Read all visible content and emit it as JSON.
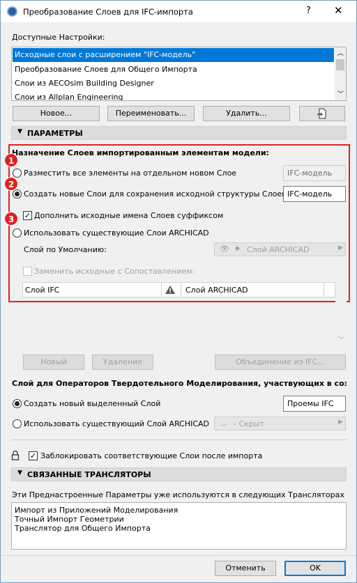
{
  "window": {
    "title": "Преобразование Слоев для IFC-импорта",
    "help": "?",
    "close": "✕"
  },
  "settings": {
    "label": "Доступные Настройки:",
    "items": [
      "Исходные слои с расширением \"IFC-модель\"",
      "Преобразование Слоев для Общего Импорта",
      "Слои из AECOsim Building Designer",
      "Слои из Allplan Engineering"
    ],
    "new_btn": "Новое...",
    "rename_btn": "Переименовать...",
    "delete_btn": "Удалить..."
  },
  "params": {
    "header": "ПАРАМЕТРЫ",
    "assign_label": "Назначение Слоев импортированным элементам модели:",
    "opt1": "Разместить все элементы на отдельном новом Слое",
    "opt1_value": "IFC-модель",
    "opt2": "Создать новые Слои для сохранения исходной структуры Слоев",
    "opt2_value": "IFC-модель",
    "suffix_check": "Дополнить исходные имена Слоев суффиксом",
    "suffix_mark": "✓",
    "opt3": "Использовать существующие Слои ARCHICAD",
    "default_layer_label": "Слой по Умолчанию:",
    "default_layer_value": "Слой ARCHICAD",
    "replace_check": "Заменить исходные с Сопоставлением:",
    "map_col1": "Слой IFC",
    "map_col2": "Слой ARCHICAD",
    "new_btn": "Новый",
    "delete_btn": "Удаление",
    "merge_btn": "Объединение из IFC...",
    "badges": [
      "1",
      "2",
      "3"
    ]
  },
  "solid_ops": {
    "label": "Слой для Операторов Твердотельного Моделирования, участвующих в создании прое",
    "opt_new": "Создать новый выделенный Слой",
    "opt_new_value": "Проемы IFC",
    "opt_existing": "Использовать существующий Слой ARCHICAD",
    "opt_existing_value": "- Скрыт"
  },
  "lock": {
    "label": "Заблокировать соответствующие Слои после импорта",
    "mark": "✓"
  },
  "translators": {
    "header": "СВЯЗАННЫЕ ТРАНСЛЯТОРЫ",
    "info": "Эти Преднастроенные Параметры уже используются в следующих Трансляторах для Импо",
    "items": [
      "Импорт из Приложений Моделирования",
      "Точный Импорт Геометрии",
      "Транслятор для Общего Импорта"
    ]
  },
  "footer": {
    "cancel": "Отменить",
    "ok": "OK"
  }
}
